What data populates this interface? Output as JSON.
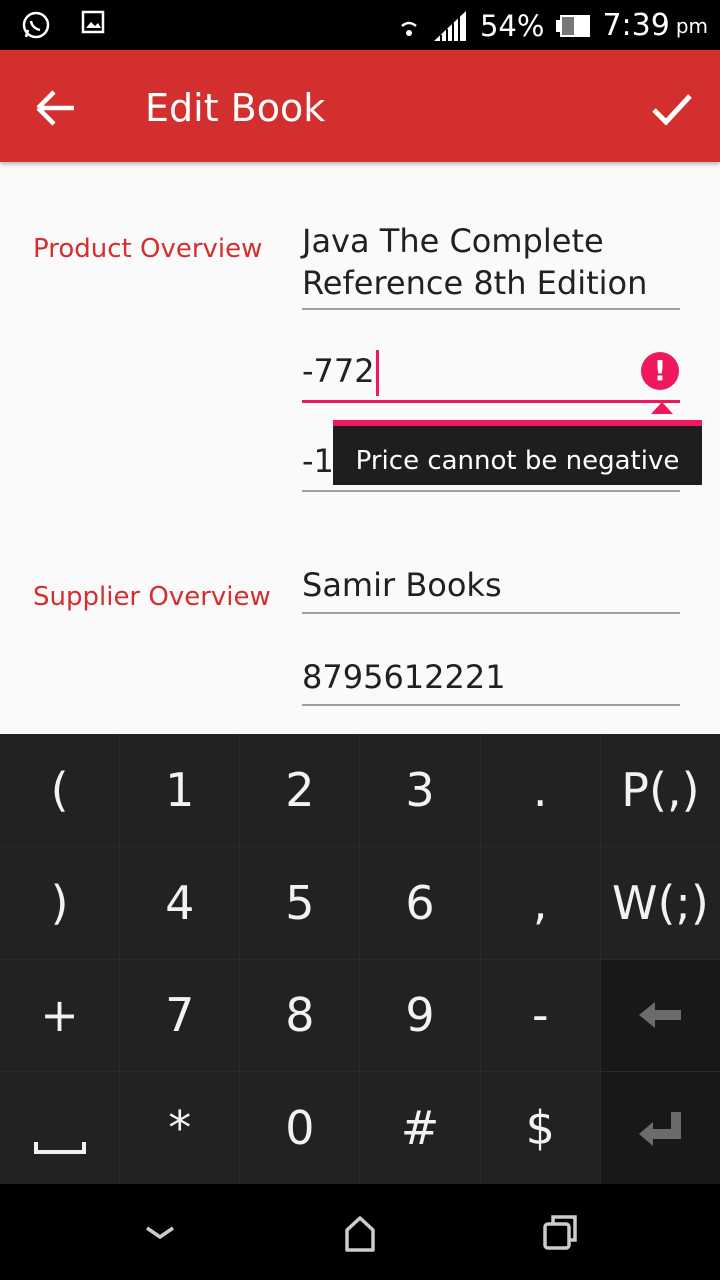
{
  "status_bar": {
    "battery": "54%",
    "time": "7:39",
    "ampm": "pm",
    "icons": [
      "whatsapp-icon",
      "image-icon",
      "wifi-icon",
      "signal-icon",
      "battery-icon"
    ]
  },
  "app_bar": {
    "title": "Edit Book",
    "colors": {
      "primary": "#d32f2f",
      "error": "#f0185c"
    }
  },
  "form": {
    "product_overview_label": "Product Overview",
    "product_name_line1": "Java The Complete",
    "product_name_line2": "Reference 8th Edition",
    "price_value": "-772",
    "quantity_value": "-180",
    "error_message": "Price cannot be negative",
    "supplier_overview_label": "Supplier Overview",
    "supplier_name": "Samir Books",
    "supplier_phone": "8795612221"
  },
  "keyboard": {
    "keys": [
      "(",
      "1",
      "2",
      "3",
      ".",
      "P(,)",
      ")",
      "4",
      "5",
      "6",
      ",",
      "W(;)",
      "+",
      "7",
      "8",
      "9",
      "-",
      "backspace-icon",
      "space-icon",
      "*",
      "0",
      "#",
      "$",
      "enter-icon"
    ]
  }
}
